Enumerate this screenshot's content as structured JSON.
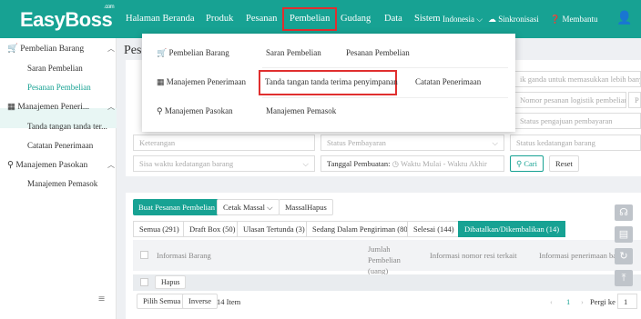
{
  "app": {
    "logo": "EasyBoss",
    "logo_sup": ".com"
  },
  "topnav": {
    "items": [
      "Halaman Beranda",
      "Produk",
      "Pesanan",
      "Pembelian",
      "Gudang",
      "Data",
      "Sistem"
    ],
    "language": "Indonesia",
    "sync": "Sinkronisasi",
    "help": "Membantu"
  },
  "sidebar": {
    "groups": [
      {
        "label": "Pembelian Barang",
        "items": [
          "Saran Pembelian",
          "Pesanan Pembelian"
        ]
      },
      {
        "label": "Manajemen Peneri...",
        "items": [
          "Tanda tangan tanda ter...",
          "Catatan Penerimaan"
        ]
      },
      {
        "label": "Manajemen Pasokan",
        "items": [
          "Manajemen Pemasok"
        ]
      }
    ]
  },
  "page": {
    "title": "Pesanan Pembelian"
  },
  "dropdown": {
    "rows": [
      {
        "category": "Pembelian Barang",
        "links": [
          "Saran Pembelian",
          "Pesanan Pembelian"
        ]
      },
      {
        "category": "Manajemen Penerimaan",
        "links": [
          "Tanda tangan tanda terima penyimpanan",
          "Catatan Penerimaan"
        ]
      },
      {
        "category": "Manajemen Pasokan",
        "links": [
          "Manajemen Pemasok"
        ]
      }
    ]
  },
  "filters": {
    "hint_right": "ik ganda untuk memasukkan lebih banyak",
    "logistics_placeholder": "Nomor pesanan logistik pembelian",
    "payment_request": "Status pengajuan pembayaran",
    "keterangan": "Keterangan",
    "payment_status": "Status Pembayaran",
    "arrival_status": "Status kedatangan barang",
    "arrival_time": "Sisa waktu kedatangan barang",
    "created_label": "Tanggal Pembuatan:",
    "start": "Waktu Mulai",
    "dash": "-",
    "end": "Waktu Akhir",
    "search": "Cari",
    "reset": "Reset"
  },
  "actions": {
    "create": "Buat Pesanan Pembelian",
    "print": "Cetak Massal",
    "bulk_delete": "MassalHapus"
  },
  "tabs": [
    "Semua (291)",
    "Draft Box (50)",
    "Ulasan Tertunda (3)",
    "Sedang Dalam Pengiriman (80)",
    "Selesai (144)",
    "Dibatalkan/Dikembalikan (14)"
  ],
  "table": {
    "headers": [
      "Informasi Barang",
      "Jumlah Pembelian (uang)",
      "Informasi nomor resi terkait",
      "Informasi penerimaan barang"
    ],
    "bulk_delete": "Hapus"
  },
  "footer": {
    "select_all": "Pilih Semua",
    "inverse": "Inverse",
    "count": "14 Item",
    "page": "1",
    "goto": "Pergi ke",
    "goto_value": "1"
  },
  "colors": {
    "brand": "#17a293",
    "highlight": "#e02f2f"
  }
}
